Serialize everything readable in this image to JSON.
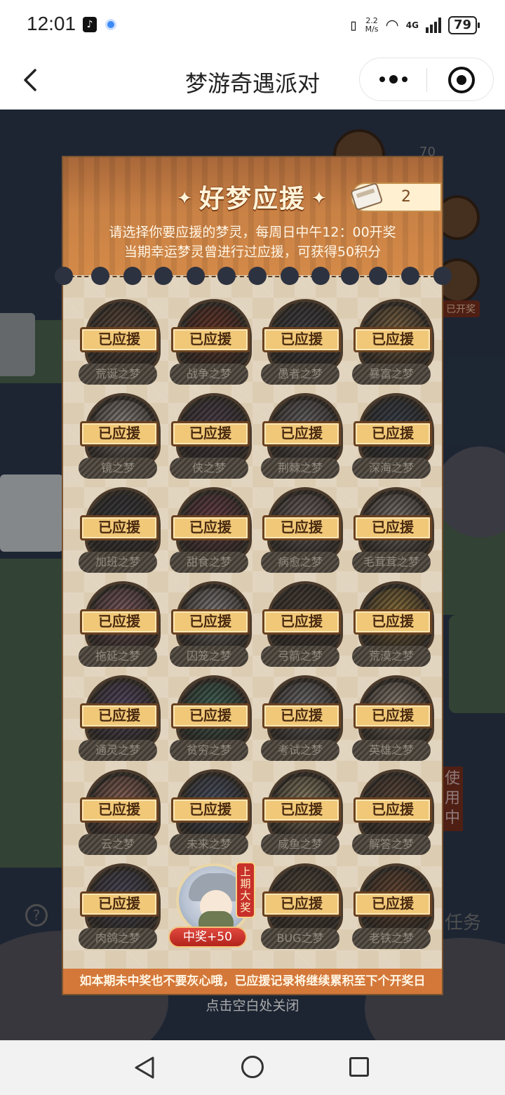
{
  "status_bar": {
    "time": "12:01",
    "net_speed_top": "2.2",
    "net_speed_bottom": "M/s",
    "signal_label": "4G",
    "battery": "79"
  },
  "nav": {
    "title": "梦游奇遇派对"
  },
  "background": {
    "score": "70",
    "tag": "已开奖",
    "vertical_text": "使用中",
    "task_text": "任务",
    "close_hint": "点击空白处关闭"
  },
  "modal": {
    "title": "好梦应援",
    "ticket_count": "2",
    "subtitle_line1": "请选择你要应援的梦灵，每周日中午12：00开奖",
    "subtitle_line2": "当期幸运梦灵曾进行过应援，可获得50积分",
    "supported_label": "已应援",
    "footer": "如本期未中奖也不要灰心哦，已应援记录将继续累积至下个开奖日",
    "dreams": [
      {
        "name": "荒诞之梦",
        "color": "#7a5a48"
      },
      {
        "name": "战争之梦",
        "color": "#8a3a2a"
      },
      {
        "name": "愚者之梦",
        "color": "#4a4a58"
      },
      {
        "name": "暴富之梦",
        "color": "#b08a58"
      },
      {
        "name": "镜之梦",
        "color": "#c8c2bc"
      },
      {
        "name": "侠之梦",
        "color": "#5a4a62"
      },
      {
        "name": "荆棘之梦",
        "color": "#8c8a92"
      },
      {
        "name": "深海之梦",
        "color": "#3a4a62"
      },
      {
        "name": "加班之梦",
        "color": "#3a3e4a"
      },
      {
        "name": "甜食之梦",
        "color": "#8a4a5a"
      },
      {
        "name": "病愈之梦",
        "color": "#9a8a8c"
      },
      {
        "name": "毛茸茸之梦",
        "color": "#b0a8a2"
      },
      {
        "name": "拖延之梦",
        "color": "#b07a8a"
      },
      {
        "name": "囚笼之梦",
        "color": "#b8b6ba"
      },
      {
        "name": "弓箭之梦",
        "color": "#5a4a42"
      },
      {
        "name": "荒漠之梦",
        "color": "#c8a04a"
      },
      {
        "name": "通灵之梦",
        "color": "#6a5a8a"
      },
      {
        "name": "贫穷之梦",
        "color": "#4a8a7a"
      },
      {
        "name": "考试之梦",
        "color": "#9a9aa2"
      },
      {
        "name": "英雄之梦",
        "color": "#c8b8a8"
      },
      {
        "name": "云之梦",
        "color": "#c88a7a"
      },
      {
        "name": "未来之梦",
        "color": "#5a6a8a"
      },
      {
        "name": "咸鱼之梦",
        "color": "#c8b890"
      },
      {
        "name": "解答之梦",
        "color": "#7a5a48"
      },
      {
        "name": "肉鸽之梦",
        "color": "#5a5a7a"
      },
      {
        "name": "中奖+50",
        "color": "#b7c2d2",
        "winner": true,
        "badge": "上期大奖"
      },
      {
        "name": "BUG之梦",
        "color": "#6a5a4a"
      },
      {
        "name": "老铁之梦",
        "color": "#8a5a3a"
      }
    ]
  }
}
